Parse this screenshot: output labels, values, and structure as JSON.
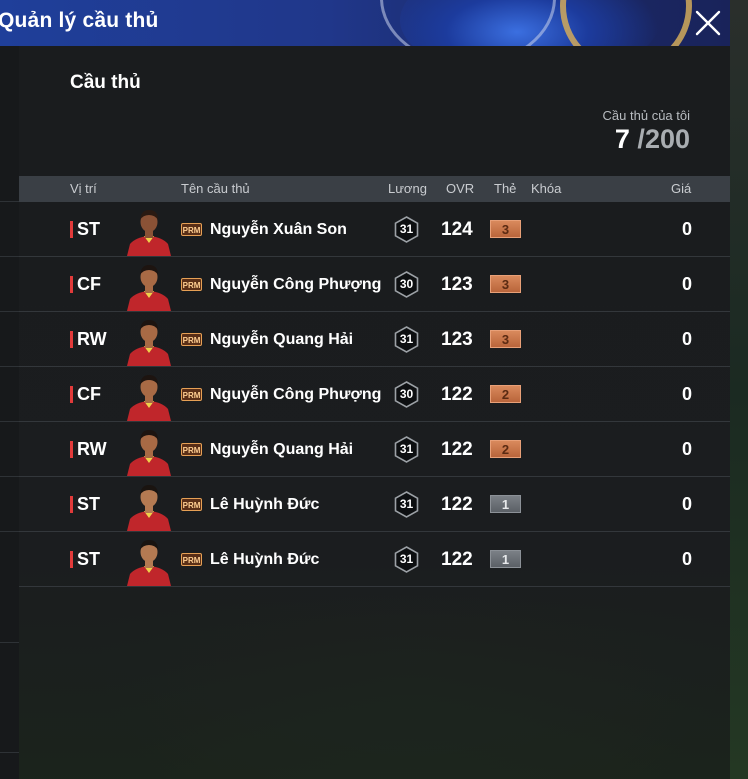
{
  "header": {
    "title": "Quản lý cầu thủ",
    "close_icon": "close-icon"
  },
  "panel": {
    "title": "Cầu thủ",
    "my_players_label": "Cầu thủ của tôi",
    "count_current": "7",
    "count_sep": " /",
    "count_max": "200"
  },
  "table": {
    "headers": {
      "position": "Vị trí",
      "name": "Tên cầu thủ",
      "salary": "Lương",
      "ovr": "OVR",
      "card": "Thẻ",
      "lock": "Khóa",
      "price": "Giá"
    },
    "rows": [
      {
        "position": "ST",
        "badge": "PRM",
        "name": "Nguyễn Xuân Son",
        "salary": "31",
        "ovr": "124",
        "card": "3",
        "card_tier": "bronze",
        "price": "0"
      },
      {
        "position": "CF",
        "badge": "PRM",
        "name": "Nguyễn Công Phượng",
        "salary": "30",
        "ovr": "123",
        "card": "3",
        "card_tier": "bronze",
        "price": "0"
      },
      {
        "position": "RW",
        "badge": "PRM",
        "name": "Nguyễn Quang Hải",
        "salary": "31",
        "ovr": "123",
        "card": "3",
        "card_tier": "bronze",
        "price": "0"
      },
      {
        "position": "CF",
        "badge": "PRM",
        "name": "Nguyễn Công Phượng",
        "salary": "30",
        "ovr": "122",
        "card": "2",
        "card_tier": "bronze",
        "price": "0"
      },
      {
        "position": "RW",
        "badge": "PRM",
        "name": "Nguyễn Quang Hải",
        "salary": "31",
        "ovr": "122",
        "card": "2",
        "card_tier": "bronze",
        "price": "0"
      },
      {
        "position": "ST",
        "badge": "PRM",
        "name": "Lê Huỳnh Đức",
        "salary": "31",
        "ovr": "122",
        "card": "1",
        "card_tier": "grey",
        "price": "0"
      },
      {
        "position": "ST",
        "badge": "PRM",
        "name": "Lê Huỳnh Đức",
        "salary": "31",
        "ovr": "122",
        "card": "1",
        "card_tier": "grey",
        "price": "0"
      }
    ]
  },
  "colors": {
    "position_marker": "#e23a3a",
    "header_bar": "#1f3f9a",
    "table_header_bg": "#3a3f45",
    "card_bronze": "#c8724a",
    "card_grey": "#6b7076"
  }
}
